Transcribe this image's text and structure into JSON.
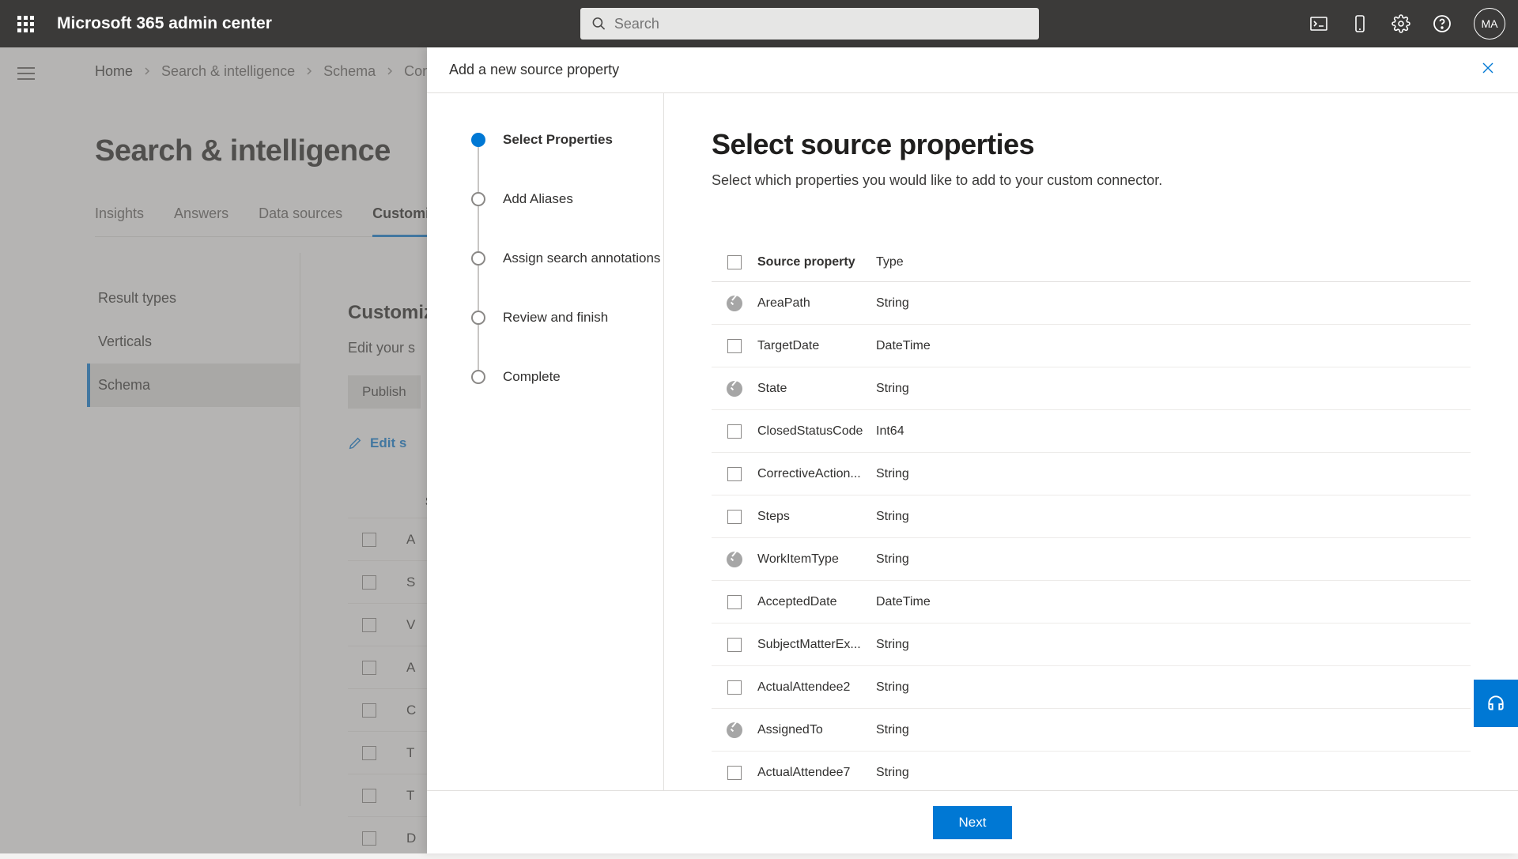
{
  "topbar": {
    "title": "Microsoft 365 admin center",
    "search_placeholder": "Search",
    "avatar": "MA"
  },
  "breadcrumb": [
    "Home",
    "Search & intelligence",
    "Schema",
    "Conn…"
  ],
  "page_title": "Search & intelligence",
  "tabs": [
    "Insights",
    "Answers",
    "Data sources",
    "Customiz"
  ],
  "active_tab_index": 3,
  "sidebar": [
    "Result types",
    "Verticals",
    "Schema"
  ],
  "sidebar_active_index": 2,
  "main": {
    "heading": "Customiz",
    "edit_text": "Edit your s",
    "publish_label": "Publish",
    "edit_semantic_label": "Edit s",
    "header_col": "S",
    "rows": [
      "A",
      "S",
      "V",
      "A",
      "C",
      "T",
      "T",
      "D"
    ]
  },
  "flyout": {
    "title": "Add a new source property",
    "steps": [
      "Select Properties",
      "Add Aliases",
      "Assign search annotations",
      "Review and finish",
      "Complete"
    ],
    "active_step_index": 0,
    "content_title": "Select source properties",
    "content_sub": "Select which properties you would like to add to your custom connector.",
    "headers": {
      "name": "Source property",
      "type": "Type"
    },
    "properties": [
      {
        "name": "AreaPath",
        "type": "String",
        "locked": true
      },
      {
        "name": "TargetDate",
        "type": "DateTime",
        "locked": false
      },
      {
        "name": "State",
        "type": "String",
        "locked": true
      },
      {
        "name": "ClosedStatusCode",
        "type": "Int64",
        "locked": false
      },
      {
        "name": "CorrectiveAction...",
        "type": "String",
        "locked": false
      },
      {
        "name": "Steps",
        "type": "String",
        "locked": false
      },
      {
        "name": "WorkItemType",
        "type": "String",
        "locked": true
      },
      {
        "name": "AcceptedDate",
        "type": "DateTime",
        "locked": false
      },
      {
        "name": "SubjectMatterEx...",
        "type": "String",
        "locked": false
      },
      {
        "name": "ActualAttendee2",
        "type": "String",
        "locked": false
      },
      {
        "name": "AssignedTo",
        "type": "String",
        "locked": true
      },
      {
        "name": "ActualAttendee7",
        "type": "String",
        "locked": false
      }
    ],
    "next_label": "Next"
  }
}
